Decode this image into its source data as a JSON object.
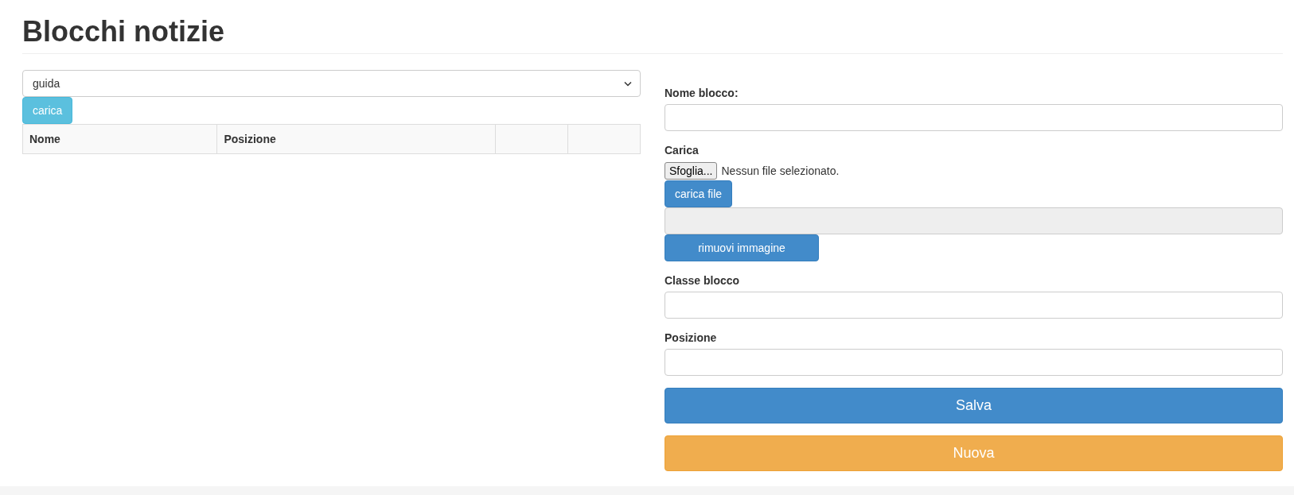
{
  "title": "Blocchi notizie",
  "left": {
    "select": {
      "value": "guida"
    },
    "load_button": "carica",
    "table": {
      "columns": [
        "Nome",
        "Posizione"
      ]
    }
  },
  "form": {
    "name_field": {
      "label": "Nome blocco:"
    },
    "upload": {
      "label": "Carica",
      "browse_button": "Sfoglia...",
      "file_status": "Nessun file selezionato.",
      "upload_button": "carica file",
      "image_path": {
        "disabled": true
      },
      "remove_button": "rimuovi immagine"
    },
    "class_field": {
      "label": "Classe blocco"
    },
    "position_field": {
      "label": "Posizione"
    },
    "buttons": [
      {
        "label": "Salva",
        "kind": "primary"
      },
      {
        "label": "Nuova",
        "kind": "warning"
      }
    ]
  }
}
